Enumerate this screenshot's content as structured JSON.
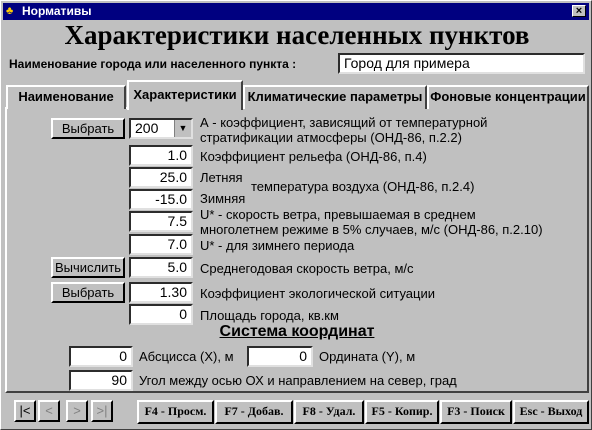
{
  "window": {
    "title": "Нормативы",
    "close_label": "×"
  },
  "heading": "Характеристики населенных пунктов",
  "city": {
    "label": "Наименование города или населенного пункта :",
    "value": "Город для примера"
  },
  "tabs": [
    {
      "label": "Наименование",
      "active": false
    },
    {
      "label": "Характеристики",
      "active": true
    },
    {
      "label": "Климатические параметры",
      "active": false
    },
    {
      "label": "Фоновые концентрации",
      "active": false
    }
  ],
  "params": {
    "select_button": "Выбрать",
    "calc_button": "Вычислить",
    "a_value": "200",
    "a_desc_1": "А - коэффициент, зависящий от температурной",
    "a_desc_2": "стратификации атмосферы (ОНД-86, п.2.2)",
    "relief_value": "1.0",
    "relief_desc": "Коэффициент  рельефа (ОНД-86, п.4)",
    "summer_value": "25.0",
    "summer_label": "Летняя",
    "temp_desc": "температура воздуха (ОНД-86, п.2.4)",
    "winter_value": "-15.0",
    "winter_label": "Зимняя",
    "wind_value": "7.5",
    "wind_desc_1": "U* - скорость ветра, превышаемая в среднем",
    "wind_desc_2": "многолетнем режиме в 5% случаев, м/с (ОНД-86, п.2.10)",
    "winter_wind_value": "7.0",
    "winter_wind_desc": "U* - для зимнего периода",
    "avg_wind_value": "5.0",
    "avg_wind_desc": "Среднегодовая скорость ветра, м/с",
    "eco_value": "1.30",
    "eco_desc": "Коэффициент  экологической ситуации",
    "area_value": "0",
    "area_desc": "Площадь города, кв.км"
  },
  "coords": {
    "title": "Система координат",
    "x_value": "0",
    "x_label": "Абсцисса (X), м",
    "y_value": "0",
    "y_label": "Ордината (Y), м",
    "angle_value": "90",
    "angle_label": "Угол между осью ОХ и направлением на север, град"
  },
  "nav": {
    "first": "|<",
    "prev": "<",
    "next": ">",
    "last": ">|"
  },
  "fkeys": [
    "F4 - Просм.",
    "F7 - Добав.",
    "F8 - Удал.",
    "F5 - Копир.",
    "F3 - Поиск",
    "Esc - Выход"
  ]
}
